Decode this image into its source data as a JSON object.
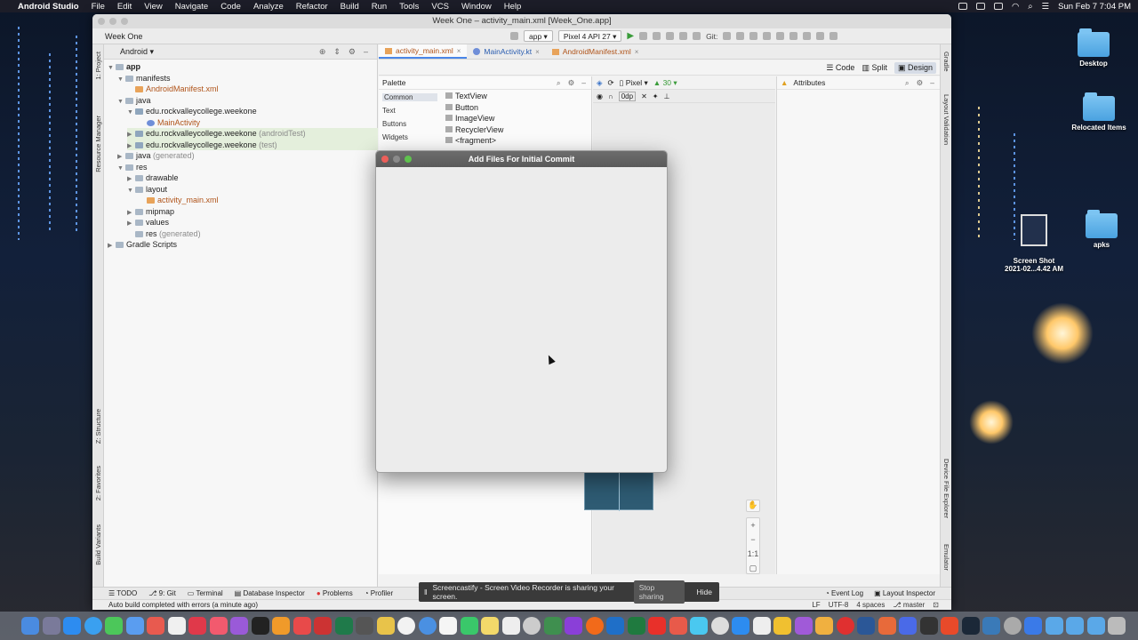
{
  "menubar": {
    "app": "Android Studio",
    "items": [
      "File",
      "Edit",
      "View",
      "Navigate",
      "Code",
      "Analyze",
      "Refactor",
      "Build",
      "Run",
      "Tools",
      "VCS",
      "Window",
      "Help"
    ],
    "clock": "Sun Feb 7  7:04 PM"
  },
  "window": {
    "title": "Week One – activity_main.xml [Week_One.app]",
    "project_name": "Week One"
  },
  "toolbar": {
    "config": "app",
    "device": "Pixel 4 API 27",
    "git_label": "Git:"
  },
  "project_panel": {
    "view_mode": "Android",
    "tree": [
      {
        "label": "app",
        "suffix": ""
      },
      {
        "label": "manifests",
        "suffix": ""
      },
      {
        "label": "AndroidManifest.xml",
        "suffix": ""
      },
      {
        "label": "java",
        "suffix": ""
      },
      {
        "label": "edu.rockvalleycollege.weekone",
        "suffix": ""
      },
      {
        "label": "MainActivity",
        "suffix": ""
      },
      {
        "label": "edu.rockvalleycollege.weekone",
        "suffix": "(androidTest)"
      },
      {
        "label": "edu.rockvalleycollege.weekone",
        "suffix": "(test)"
      },
      {
        "label": "java",
        "suffix": "(generated)"
      },
      {
        "label": "res",
        "suffix": ""
      },
      {
        "label": "drawable",
        "suffix": ""
      },
      {
        "label": "layout",
        "suffix": ""
      },
      {
        "label": "activity_main.xml",
        "suffix": ""
      },
      {
        "label": "mipmap",
        "suffix": ""
      },
      {
        "label": "values",
        "suffix": ""
      },
      {
        "label": "res",
        "suffix": "(generated)"
      },
      {
        "label": "Gradle Scripts",
        "suffix": ""
      }
    ]
  },
  "side_tabs": {
    "left": [
      "1: Project",
      "Resource Manager",
      "Z: Structure",
      "2: Favorites",
      "Build Variants"
    ],
    "right": [
      "Gradle",
      "Layout Validation",
      "Device File Explorer",
      "Emulator"
    ]
  },
  "editor_tabs": [
    {
      "label": "activity_main.xml"
    },
    {
      "label": "MainActivity.kt"
    },
    {
      "label": "AndroidManifest.xml"
    }
  ],
  "view_modes": [
    "Code",
    "Split",
    "Design"
  ],
  "palette": {
    "title": "Palette",
    "categories": [
      "Common",
      "Text",
      "Buttons",
      "Widgets"
    ],
    "items": [
      "TextView",
      "Button",
      "ImageView",
      "RecyclerView",
      "<fragment>"
    ]
  },
  "design_toolbar": {
    "device": "Pixel",
    "api": "30",
    "margin": "0dp"
  },
  "attributes_title": "Attributes",
  "zoom_controls": {
    "ratio": "1:1"
  },
  "dialog": {
    "title": "Add Files For Initial Commit"
  },
  "tool_windows": [
    "TODO",
    "9: Git",
    "Terminal",
    "Database Inspector",
    "Problems",
    "Profiler"
  ],
  "tool_windows_right": [
    "Event Log",
    "Layout Inspector"
  ],
  "status": {
    "message": "Auto build completed with errors (a minute ago)",
    "line_sep": "LF",
    "encoding": "UTF-8",
    "indent": "4 spaces",
    "branch": "master"
  },
  "banner": {
    "text": "Screencastify - Screen Video Recorder is sharing your screen.",
    "stop": "Stop sharing",
    "hide": "Hide"
  },
  "desktop_icons": [
    {
      "label": "Desktop"
    },
    {
      "label": "Relocated Items"
    },
    {
      "label": "Screen Shot\n2021-02...4.42 AM"
    },
    {
      "label": "apks"
    }
  ]
}
